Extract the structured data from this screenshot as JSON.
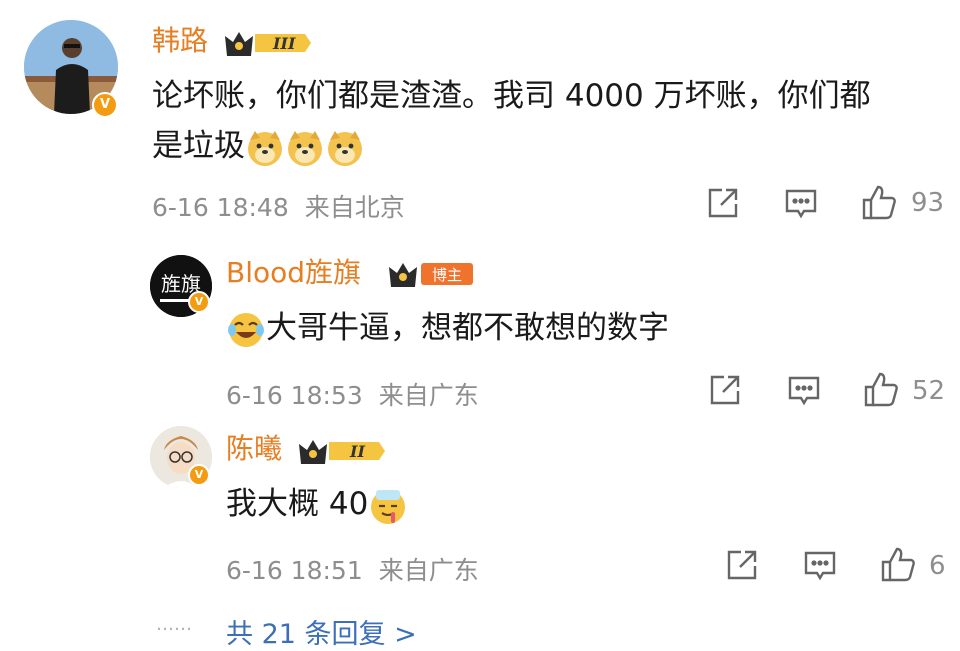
{
  "comments": [
    {
      "author": "韩路",
      "level": "III",
      "text_line1": "论坏账，你们都是渣渣。我司 4000 万坏账，你们都",
      "text_line2": "是垃圾",
      "emoji": "doge-emoji",
      "time": "6-16 18:48",
      "location": "来自北京",
      "likes": "93"
    },
    {
      "author": "Blood旌旗",
      "level_badge": "博主",
      "avatar_text": "旌旗",
      "text": "大哥牛逼，想都不敢想的数字",
      "emoji": "laughing-tears-emoji",
      "time": "6-16 18:53",
      "location": "来自广东",
      "likes": "52"
    },
    {
      "author": "陈曦",
      "level": "II",
      "text": "我大概 40",
      "emoji": "sick-face-emoji",
      "time": "6-16 18:51",
      "location": "来自广东",
      "likes": "6"
    }
  ],
  "more_dots": "……",
  "more_replies": "共 21 条回复 >",
  "colors": {
    "name": "#e67e22",
    "link": "#3d6fb8",
    "meta": "#8e8e8e",
    "verified": "#f39c12"
  }
}
